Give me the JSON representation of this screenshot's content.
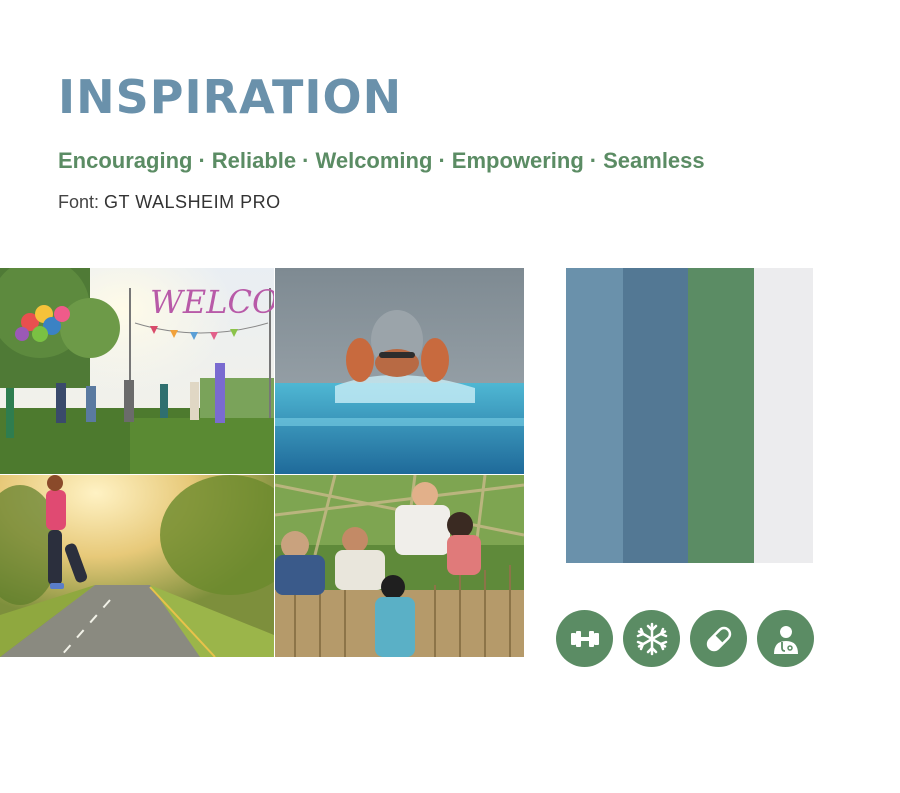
{
  "title": "INSPIRATION",
  "values": [
    "Encouraging",
    "Reliable",
    "Welcoming",
    "Empowering",
    "Seamless"
  ],
  "separator": "·",
  "font_line": {
    "label": "Font:",
    "name": "GT WALSHEIM PRO"
  },
  "photos": [
    {
      "subject": "community welcome event with balloons",
      "sign_text": "WELCOME"
    },
    {
      "subject": "swimmer doing butterfly stroke"
    },
    {
      "subject": "runner stretching on a sunny road"
    },
    {
      "subject": "group helping a child over a wooden fence"
    }
  ],
  "palette": [
    {
      "color": "#6a91ab"
    },
    {
      "color": "#537894"
    },
    {
      "color": "#5b8c64"
    },
    {
      "color": "#ececee"
    }
  ],
  "icons": [
    {
      "name": "dumbbell-icon"
    },
    {
      "name": "snowflake-icon"
    },
    {
      "name": "pill-icon"
    },
    {
      "name": "doctor-icon"
    }
  ],
  "colors": {
    "title": "#6a91ab",
    "accent": "#5b8c64",
    "text": "#444444"
  }
}
